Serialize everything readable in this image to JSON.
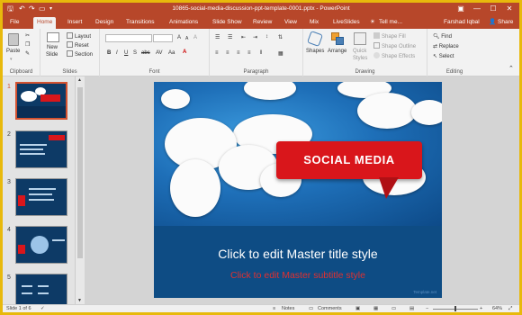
{
  "window": {
    "title": "10865-social-media-discussion-ppt-template-0001.pptx  -  PowerPoint",
    "controls": [
      "—",
      "☐",
      "✕"
    ]
  },
  "tabs": [
    {
      "label": "File"
    },
    {
      "label": "Home"
    },
    {
      "label": "Insert"
    },
    {
      "label": "Design"
    },
    {
      "label": "Transitions"
    },
    {
      "label": "Animations"
    },
    {
      "label": "Slide Show"
    },
    {
      "label": "Review"
    },
    {
      "label": "View"
    },
    {
      "label": "Mix"
    },
    {
      "label": "LiveSlides"
    },
    {
      "label": "Tell me..."
    }
  ],
  "user": {
    "name": "Farshad Iqbal",
    "share_label": "Share"
  },
  "ribbon": {
    "clipboard": {
      "paste": "Paste",
      "label": "Clipboard"
    },
    "slides": {
      "new_slide": "New",
      "new_slide2": "Slide",
      "layout": "Layout",
      "reset": "Reset",
      "section": "Section",
      "label": "Slides"
    },
    "font": {
      "label": "Font",
      "bold": "B",
      "italic": "I",
      "underline": "U",
      "strike": "S",
      "shadow": "abc",
      "spacing": "AV",
      "case": "Aa",
      "grow": "A",
      "shrink": "A",
      "clear": "A"
    },
    "paragraph": {
      "label": "Paragraph"
    },
    "drawing": {
      "shapes": "Shapes",
      "arrange": "Arrange",
      "quick": "Quick",
      "styles": "Styles",
      "fill": "Shape Fill",
      "outline": "Shape Outline",
      "effects": "Shape Effects",
      "label": "Drawing"
    },
    "editing": {
      "find": "Find",
      "replace": "Replace",
      "select": "Select",
      "label": "Editing"
    }
  },
  "thumbnails": [
    {
      "num": "1",
      "selected": true
    },
    {
      "num": "2"
    },
    {
      "num": "3"
    },
    {
      "num": "4"
    },
    {
      "num": "5"
    }
  ],
  "slide": {
    "banner": "SOCIAL MEDIA",
    "title": "Click to edit Master title style",
    "subtitle": "Click to edit Master subtitle style",
    "footer": "Template.net",
    "colors": {
      "banner": "#d9161b",
      "subtitle": "#e03030",
      "background": "#0e4c84"
    }
  },
  "status": {
    "slide": "Slide 1 of 6",
    "notes": "Notes",
    "comments": "Comments",
    "zoom": "64%",
    "zoom_minus": "−",
    "zoom_plus": "+"
  }
}
